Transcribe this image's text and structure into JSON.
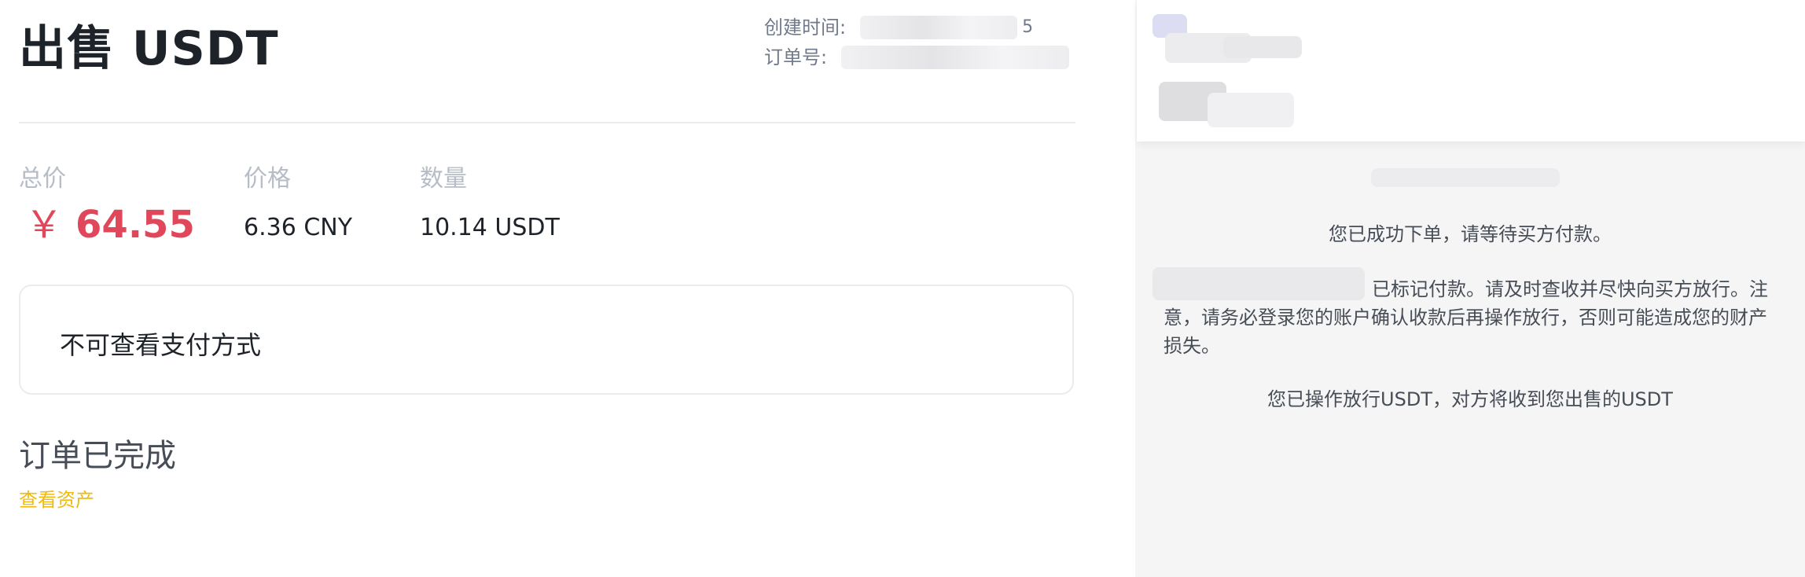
{
  "order": {
    "title": "出售 USDT",
    "created_label": "创建时间:",
    "created_visible_suffix": "5",
    "order_no_label": "订单号:"
  },
  "stats": {
    "total_label": "总价",
    "total_currency_symbol": "￥",
    "total_value": "64.55",
    "price_label": "价格",
    "price_value": "6.36 CNY",
    "quantity_label": "数量",
    "quantity_value": "10.14 USDT"
  },
  "payment": {
    "text": "不可查看支付方式"
  },
  "status": {
    "title": "订单已完成",
    "link_label": "查看资产"
  },
  "chat": {
    "messages": [
      "您已成功下单，请等待买方付款。",
      "已标记付款。请及时查收并尽快向买方放行。注意，请务必登录您的账户确认收款后再操作放行，否则可能造成您的财产损失。",
      "您已操作放行USDT，对方将收到您出售的USDT"
    ]
  },
  "colors": {
    "accent_red": "#e0475a",
    "accent_yellow": "#f0b90b",
    "muted_label": "#b7bdc6",
    "chat_background": "#f5f5f5"
  }
}
